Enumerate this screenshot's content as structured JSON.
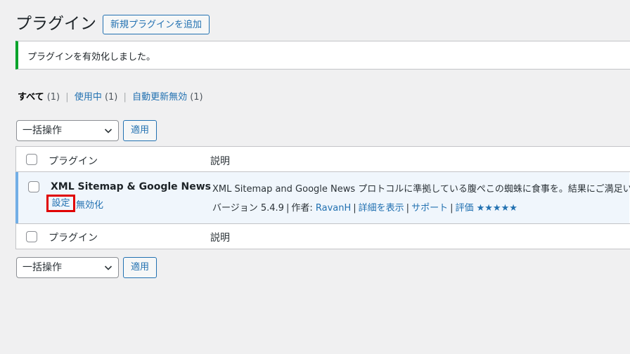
{
  "header": {
    "title": "プラグイン",
    "add_new_label": "新規プラグインを追加"
  },
  "notice": {
    "message": "プラグインを有効化しました。"
  },
  "filters": {
    "all_label": "すべて",
    "all_count": "(1)",
    "active_label": "使用中",
    "active_count": "(1)",
    "autoupdate_label": "自動更新無効",
    "autoupdate_count": "(1)"
  },
  "bulk_actions": {
    "selected": "一括操作",
    "apply_label": "適用"
  },
  "table": {
    "col_plugin": "プラグイン",
    "col_description": "説明",
    "plugin": {
      "name": "XML Sitemap & Google News",
      "settings_label": "設定",
      "deactivate_label": "無効化",
      "description": "XML Sitemap and Google News プロトコルに準拠している腹ぺこの蜘蛛に食事を。結果にご満足いただ",
      "version_text": "バージョン 5.4.9",
      "author_prefix": "作者:",
      "author": "RavanH",
      "details_label": "詳細を表示",
      "support_label": "サポート",
      "rating_label": "評価",
      "stars": "★★★★★"
    }
  },
  "colors": {
    "accent": "#2271b1",
    "success": "#00a32a",
    "highlight": "#e00000",
    "active_row": "#f0f6fc"
  }
}
